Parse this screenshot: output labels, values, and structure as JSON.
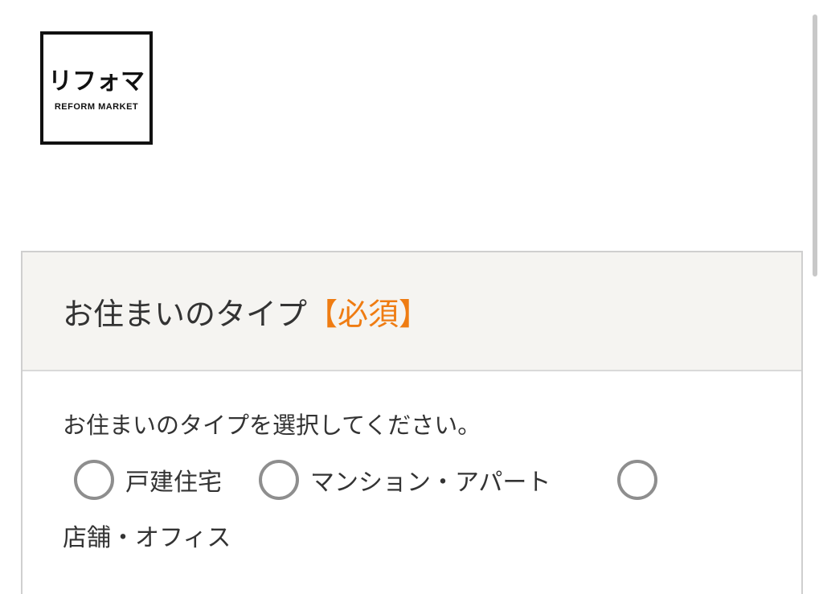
{
  "logo": {
    "main": "リフォマ",
    "sub": "REFORM MARKET"
  },
  "form": {
    "title": "お住まいのタイプ",
    "required_label": "【必須】",
    "instruction": "お住まいのタイプを選択してください。",
    "options": [
      {
        "label": "戸建住宅",
        "selected": false
      },
      {
        "label": "マンション・アパート",
        "selected": false
      },
      {
        "label": "店舗・オフィス",
        "selected": false
      }
    ]
  },
  "colors": {
    "accent": "#ef7c12",
    "header_bg": "#f5f4f1",
    "radio_border": "#8e8e8e"
  }
}
